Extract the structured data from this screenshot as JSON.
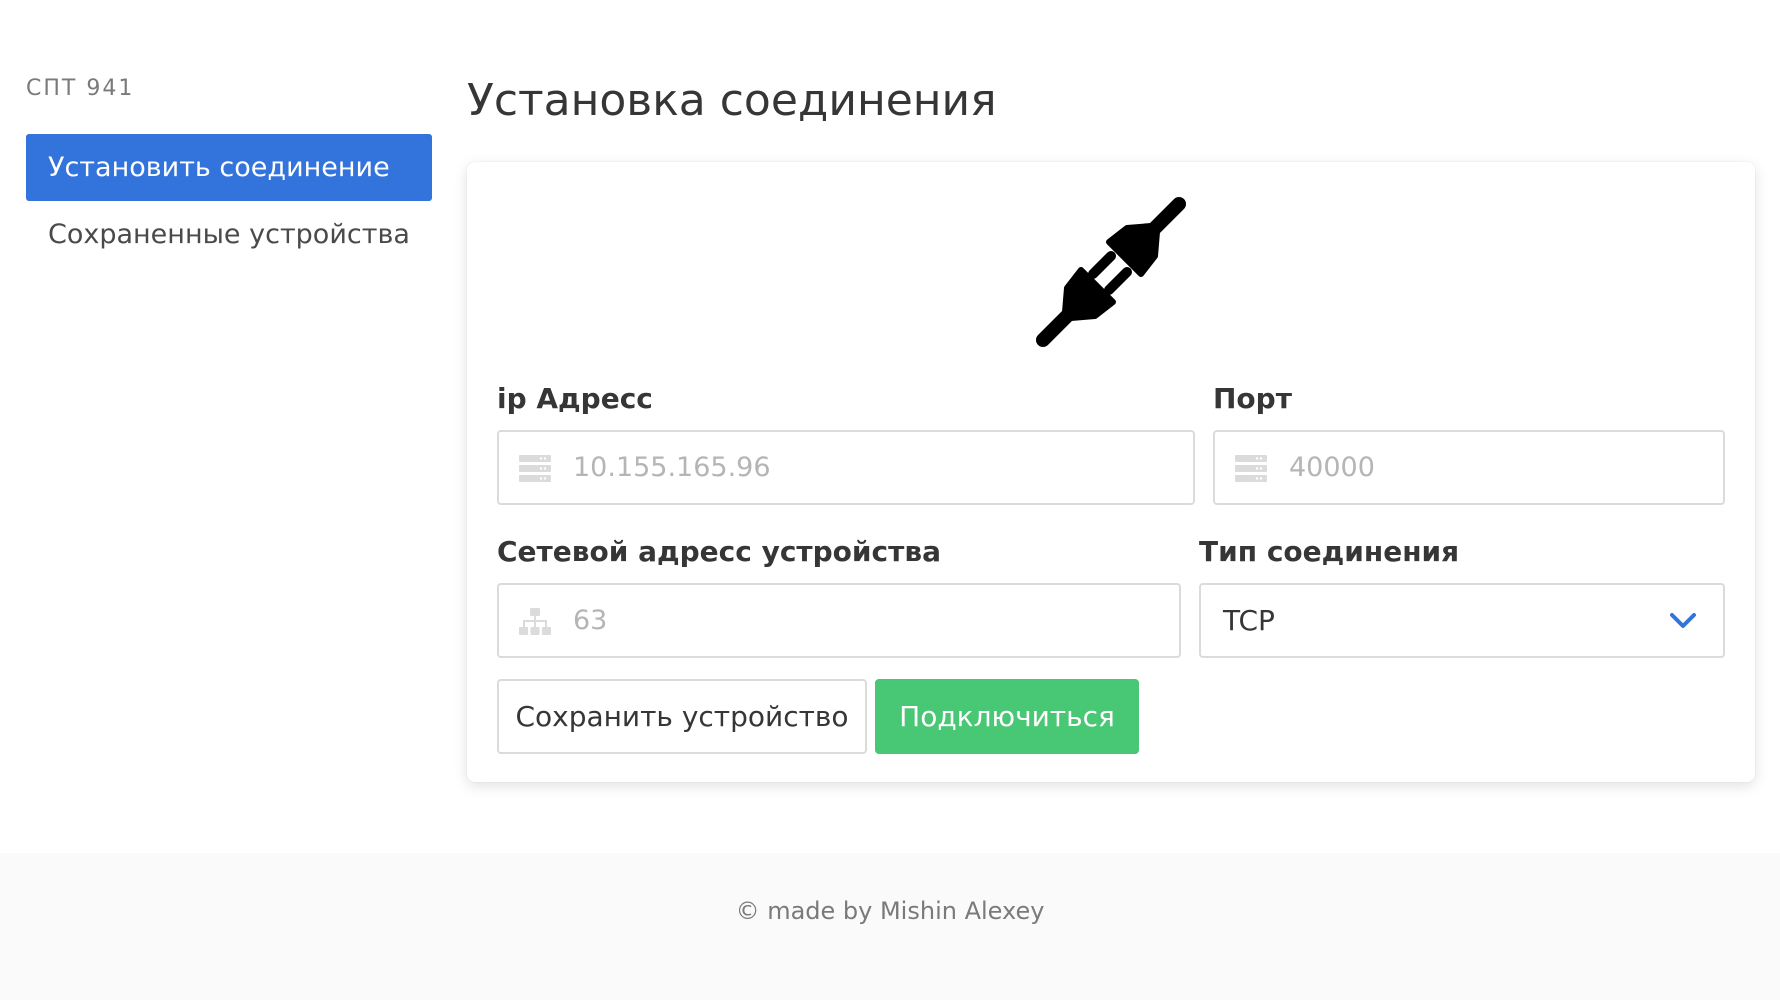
{
  "sidebar": {
    "label": "СПТ 941",
    "items": [
      {
        "label": "Установить соединение",
        "active": true
      },
      {
        "label": "Сохраненные устройства",
        "active": false
      }
    ]
  },
  "main": {
    "title": "Установка соединения",
    "hero_icon": "plug-icon",
    "form": {
      "ip": {
        "label": "ip Адресс",
        "placeholder": "10.155.165.96",
        "value": "",
        "icon": "server-icon"
      },
      "port": {
        "label": "Порт",
        "placeholder": "40000",
        "value": "",
        "icon": "server-icon"
      },
      "net_address": {
        "label": "Сетевой адресс устройства",
        "placeholder": "63",
        "value": "",
        "icon": "sitemap-icon"
      },
      "conn_type": {
        "label": "Тип соединения",
        "selected": "TCP",
        "icon": "chevron-down-icon"
      },
      "save_label": "Сохранить устройство",
      "connect_label": "Подключиться"
    }
  },
  "footer": {
    "text": "© made by Mishin Alexey"
  },
  "colors": {
    "primary": "#3273dc",
    "success": "#48c774",
    "footer_bg": "#fafafa",
    "text": "#363636",
    "muted": "#7a7a7a"
  }
}
